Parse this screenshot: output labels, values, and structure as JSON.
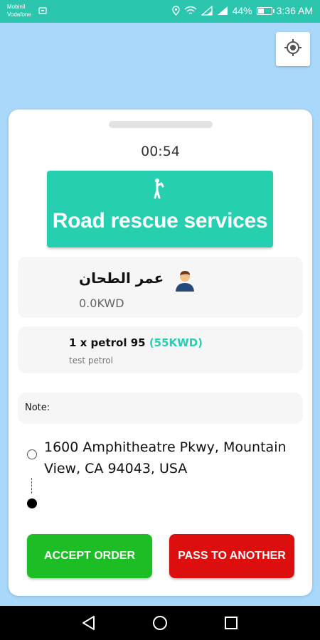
{
  "status_bar": {
    "carrier_line1": "Mobinil",
    "carrier_line2": "Vodafone",
    "battery": "44%",
    "battery_level": 0.44,
    "time": "3:36 AM",
    "bg_color": "#2bc6ad"
  },
  "map": {
    "locate_icon": "crosshair-icon",
    "bg_color": "#a9d8fb"
  },
  "order": {
    "timer": "00:54",
    "service": {
      "icon": "person-walking-icon",
      "title": "Road rescue services",
      "color": "#26cfb0"
    },
    "customer": {
      "name": "عمر الطحان",
      "balance": "0.0KWD",
      "avatar": "user-avatar-icon"
    },
    "item": {
      "quantity_name": "1 x petrol 95",
      "price": "(55KWD)",
      "description": "test petrol"
    },
    "note_label": "Note:",
    "address": "1600 Amphitheatre Pkwy, Mountain View, CA 94043, USA"
  },
  "actions": {
    "accept": "ACCEPT ORDER",
    "pass": "PASS TO ANOTHER",
    "accept_color": "#1cbd25",
    "pass_color": "#dd0e0e"
  },
  "nav": {
    "back_icon": "back-triangle-icon",
    "home_icon": "home-circle-icon",
    "recents_icon": "recents-square-icon"
  }
}
